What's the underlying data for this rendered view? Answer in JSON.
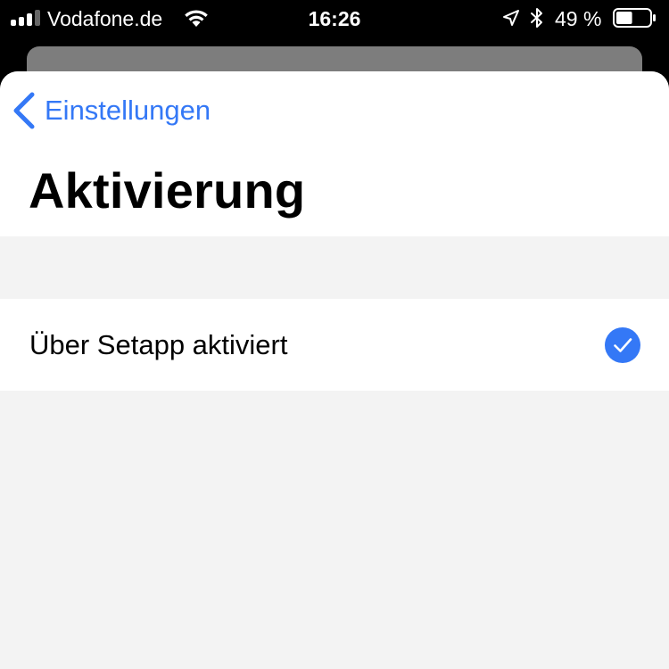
{
  "status_bar": {
    "carrier": "Vodafone.de",
    "time": "16:26",
    "battery_percent": "49 %",
    "battery_level": 0.49,
    "signal_bars": 3,
    "signal_bars_total": 4,
    "icons": [
      "signal-icon",
      "wifi-icon",
      "location-arrow-icon",
      "bluetooth-icon",
      "battery-icon"
    ]
  },
  "nav": {
    "back_label": "Einstellungen",
    "back_icon": "chevron-left-icon",
    "title": "Aktivierung"
  },
  "options": [
    {
      "label": "Über Setapp aktiviert",
      "selected": true,
      "icon": "checkmark-circle-icon"
    }
  ],
  "colors": {
    "accent": "#3478f6",
    "sheet_background": "#f3f3f3",
    "status_bar_background": "#000000",
    "checkmark_fill": "#3478f6"
  }
}
